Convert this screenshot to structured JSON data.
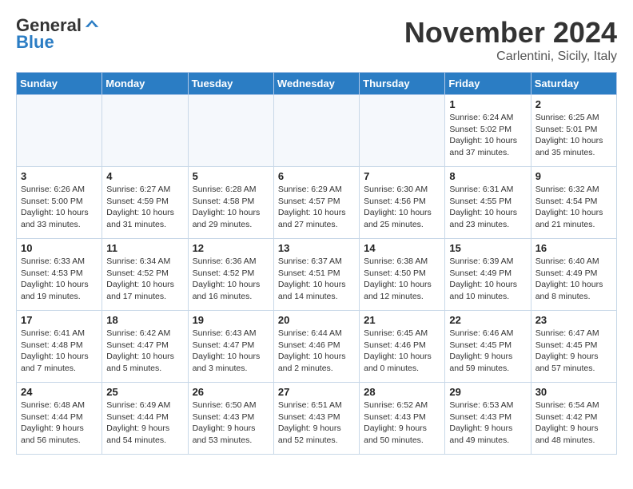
{
  "header": {
    "logo_line1": "General",
    "logo_line2": "Blue",
    "month_title": "November 2024",
    "subtitle": "Carlentini, Sicily, Italy"
  },
  "weekdays": [
    "Sunday",
    "Monday",
    "Tuesday",
    "Wednesday",
    "Thursday",
    "Friday",
    "Saturday"
  ],
  "weeks": [
    [
      {
        "day": "",
        "info": ""
      },
      {
        "day": "",
        "info": ""
      },
      {
        "day": "",
        "info": ""
      },
      {
        "day": "",
        "info": ""
      },
      {
        "day": "",
        "info": ""
      },
      {
        "day": "1",
        "info": "Sunrise: 6:24 AM\nSunset: 5:02 PM\nDaylight: 10 hours\nand 37 minutes."
      },
      {
        "day": "2",
        "info": "Sunrise: 6:25 AM\nSunset: 5:01 PM\nDaylight: 10 hours\nand 35 minutes."
      }
    ],
    [
      {
        "day": "3",
        "info": "Sunrise: 6:26 AM\nSunset: 5:00 PM\nDaylight: 10 hours\nand 33 minutes."
      },
      {
        "day": "4",
        "info": "Sunrise: 6:27 AM\nSunset: 4:59 PM\nDaylight: 10 hours\nand 31 minutes."
      },
      {
        "day": "5",
        "info": "Sunrise: 6:28 AM\nSunset: 4:58 PM\nDaylight: 10 hours\nand 29 minutes."
      },
      {
        "day": "6",
        "info": "Sunrise: 6:29 AM\nSunset: 4:57 PM\nDaylight: 10 hours\nand 27 minutes."
      },
      {
        "day": "7",
        "info": "Sunrise: 6:30 AM\nSunset: 4:56 PM\nDaylight: 10 hours\nand 25 minutes."
      },
      {
        "day": "8",
        "info": "Sunrise: 6:31 AM\nSunset: 4:55 PM\nDaylight: 10 hours\nand 23 minutes."
      },
      {
        "day": "9",
        "info": "Sunrise: 6:32 AM\nSunset: 4:54 PM\nDaylight: 10 hours\nand 21 minutes."
      }
    ],
    [
      {
        "day": "10",
        "info": "Sunrise: 6:33 AM\nSunset: 4:53 PM\nDaylight: 10 hours\nand 19 minutes."
      },
      {
        "day": "11",
        "info": "Sunrise: 6:34 AM\nSunset: 4:52 PM\nDaylight: 10 hours\nand 17 minutes."
      },
      {
        "day": "12",
        "info": "Sunrise: 6:36 AM\nSunset: 4:52 PM\nDaylight: 10 hours\nand 16 minutes."
      },
      {
        "day": "13",
        "info": "Sunrise: 6:37 AM\nSunset: 4:51 PM\nDaylight: 10 hours\nand 14 minutes."
      },
      {
        "day": "14",
        "info": "Sunrise: 6:38 AM\nSunset: 4:50 PM\nDaylight: 10 hours\nand 12 minutes."
      },
      {
        "day": "15",
        "info": "Sunrise: 6:39 AM\nSunset: 4:49 PM\nDaylight: 10 hours\nand 10 minutes."
      },
      {
        "day": "16",
        "info": "Sunrise: 6:40 AM\nSunset: 4:49 PM\nDaylight: 10 hours\nand 8 minutes."
      }
    ],
    [
      {
        "day": "17",
        "info": "Sunrise: 6:41 AM\nSunset: 4:48 PM\nDaylight: 10 hours\nand 7 minutes."
      },
      {
        "day": "18",
        "info": "Sunrise: 6:42 AM\nSunset: 4:47 PM\nDaylight: 10 hours\nand 5 minutes."
      },
      {
        "day": "19",
        "info": "Sunrise: 6:43 AM\nSunset: 4:47 PM\nDaylight: 10 hours\nand 3 minutes."
      },
      {
        "day": "20",
        "info": "Sunrise: 6:44 AM\nSunset: 4:46 PM\nDaylight: 10 hours\nand 2 minutes."
      },
      {
        "day": "21",
        "info": "Sunrise: 6:45 AM\nSunset: 4:46 PM\nDaylight: 10 hours\nand 0 minutes."
      },
      {
        "day": "22",
        "info": "Sunrise: 6:46 AM\nSunset: 4:45 PM\nDaylight: 9 hours\nand 59 minutes."
      },
      {
        "day": "23",
        "info": "Sunrise: 6:47 AM\nSunset: 4:45 PM\nDaylight: 9 hours\nand 57 minutes."
      }
    ],
    [
      {
        "day": "24",
        "info": "Sunrise: 6:48 AM\nSunset: 4:44 PM\nDaylight: 9 hours\nand 56 minutes."
      },
      {
        "day": "25",
        "info": "Sunrise: 6:49 AM\nSunset: 4:44 PM\nDaylight: 9 hours\nand 54 minutes."
      },
      {
        "day": "26",
        "info": "Sunrise: 6:50 AM\nSunset: 4:43 PM\nDaylight: 9 hours\nand 53 minutes."
      },
      {
        "day": "27",
        "info": "Sunrise: 6:51 AM\nSunset: 4:43 PM\nDaylight: 9 hours\nand 52 minutes."
      },
      {
        "day": "28",
        "info": "Sunrise: 6:52 AM\nSunset: 4:43 PM\nDaylight: 9 hours\nand 50 minutes."
      },
      {
        "day": "29",
        "info": "Sunrise: 6:53 AM\nSunset: 4:43 PM\nDaylight: 9 hours\nand 49 minutes."
      },
      {
        "day": "30",
        "info": "Sunrise: 6:54 AM\nSunset: 4:42 PM\nDaylight: 9 hours\nand 48 minutes."
      }
    ]
  ]
}
